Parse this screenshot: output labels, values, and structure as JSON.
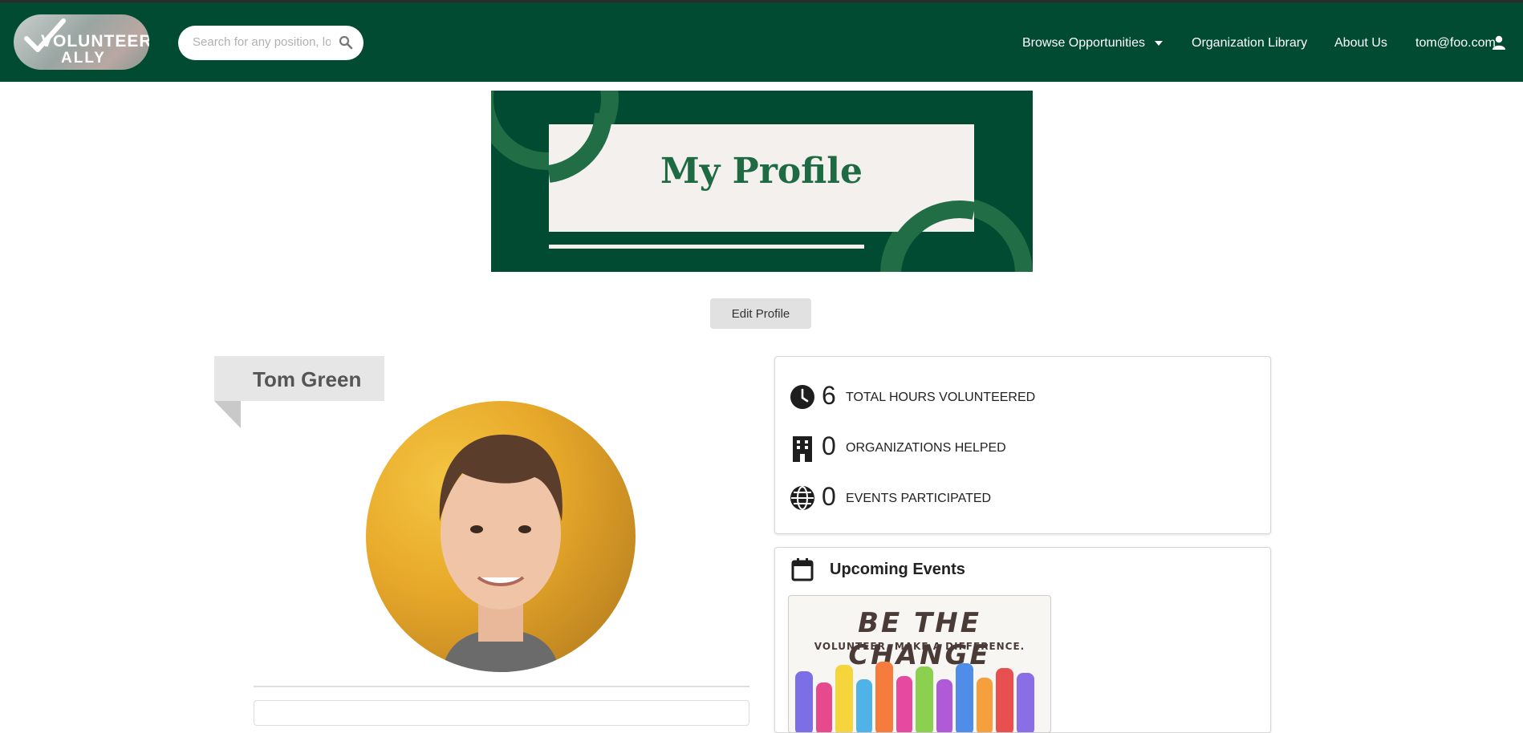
{
  "colors": {
    "nav_bg": "#004b32",
    "banner_accent": "#1e6b43",
    "card_bg": "#f3f0ee"
  },
  "nav": {
    "logo_line1": "VOLUNTEER",
    "logo_line2": "ALLY",
    "search_placeholder": "Search for any position, lo",
    "browse": "Browse Opportunities",
    "library": "Organization Library",
    "about": "About Us",
    "user": "tom@foo.com",
    "icons": {
      "search": "search-icon",
      "dropdown": "caret-down-icon",
      "user": "user-icon"
    }
  },
  "banner": {
    "title": "My Profile"
  },
  "edit_button": "Edit Profile",
  "profile": {
    "name": "Tom Green"
  },
  "stats": [
    {
      "icon": "clock-icon",
      "value": "6",
      "label": "TOTAL HOURS VOLUNTEERED"
    },
    {
      "icon": "building-icon",
      "value": "0",
      "label": "ORGANIZATIONS HELPED"
    },
    {
      "icon": "globe-icon",
      "value": "0",
      "label": "EVENTS PARTICIPATED"
    }
  ],
  "events": {
    "icon": "calendar-icon",
    "title": "Upcoming Events",
    "poster_title": "BE THE CHANGE",
    "poster_subtitle": "VOLUNTEER. MAKE A DIFFERENCE."
  }
}
